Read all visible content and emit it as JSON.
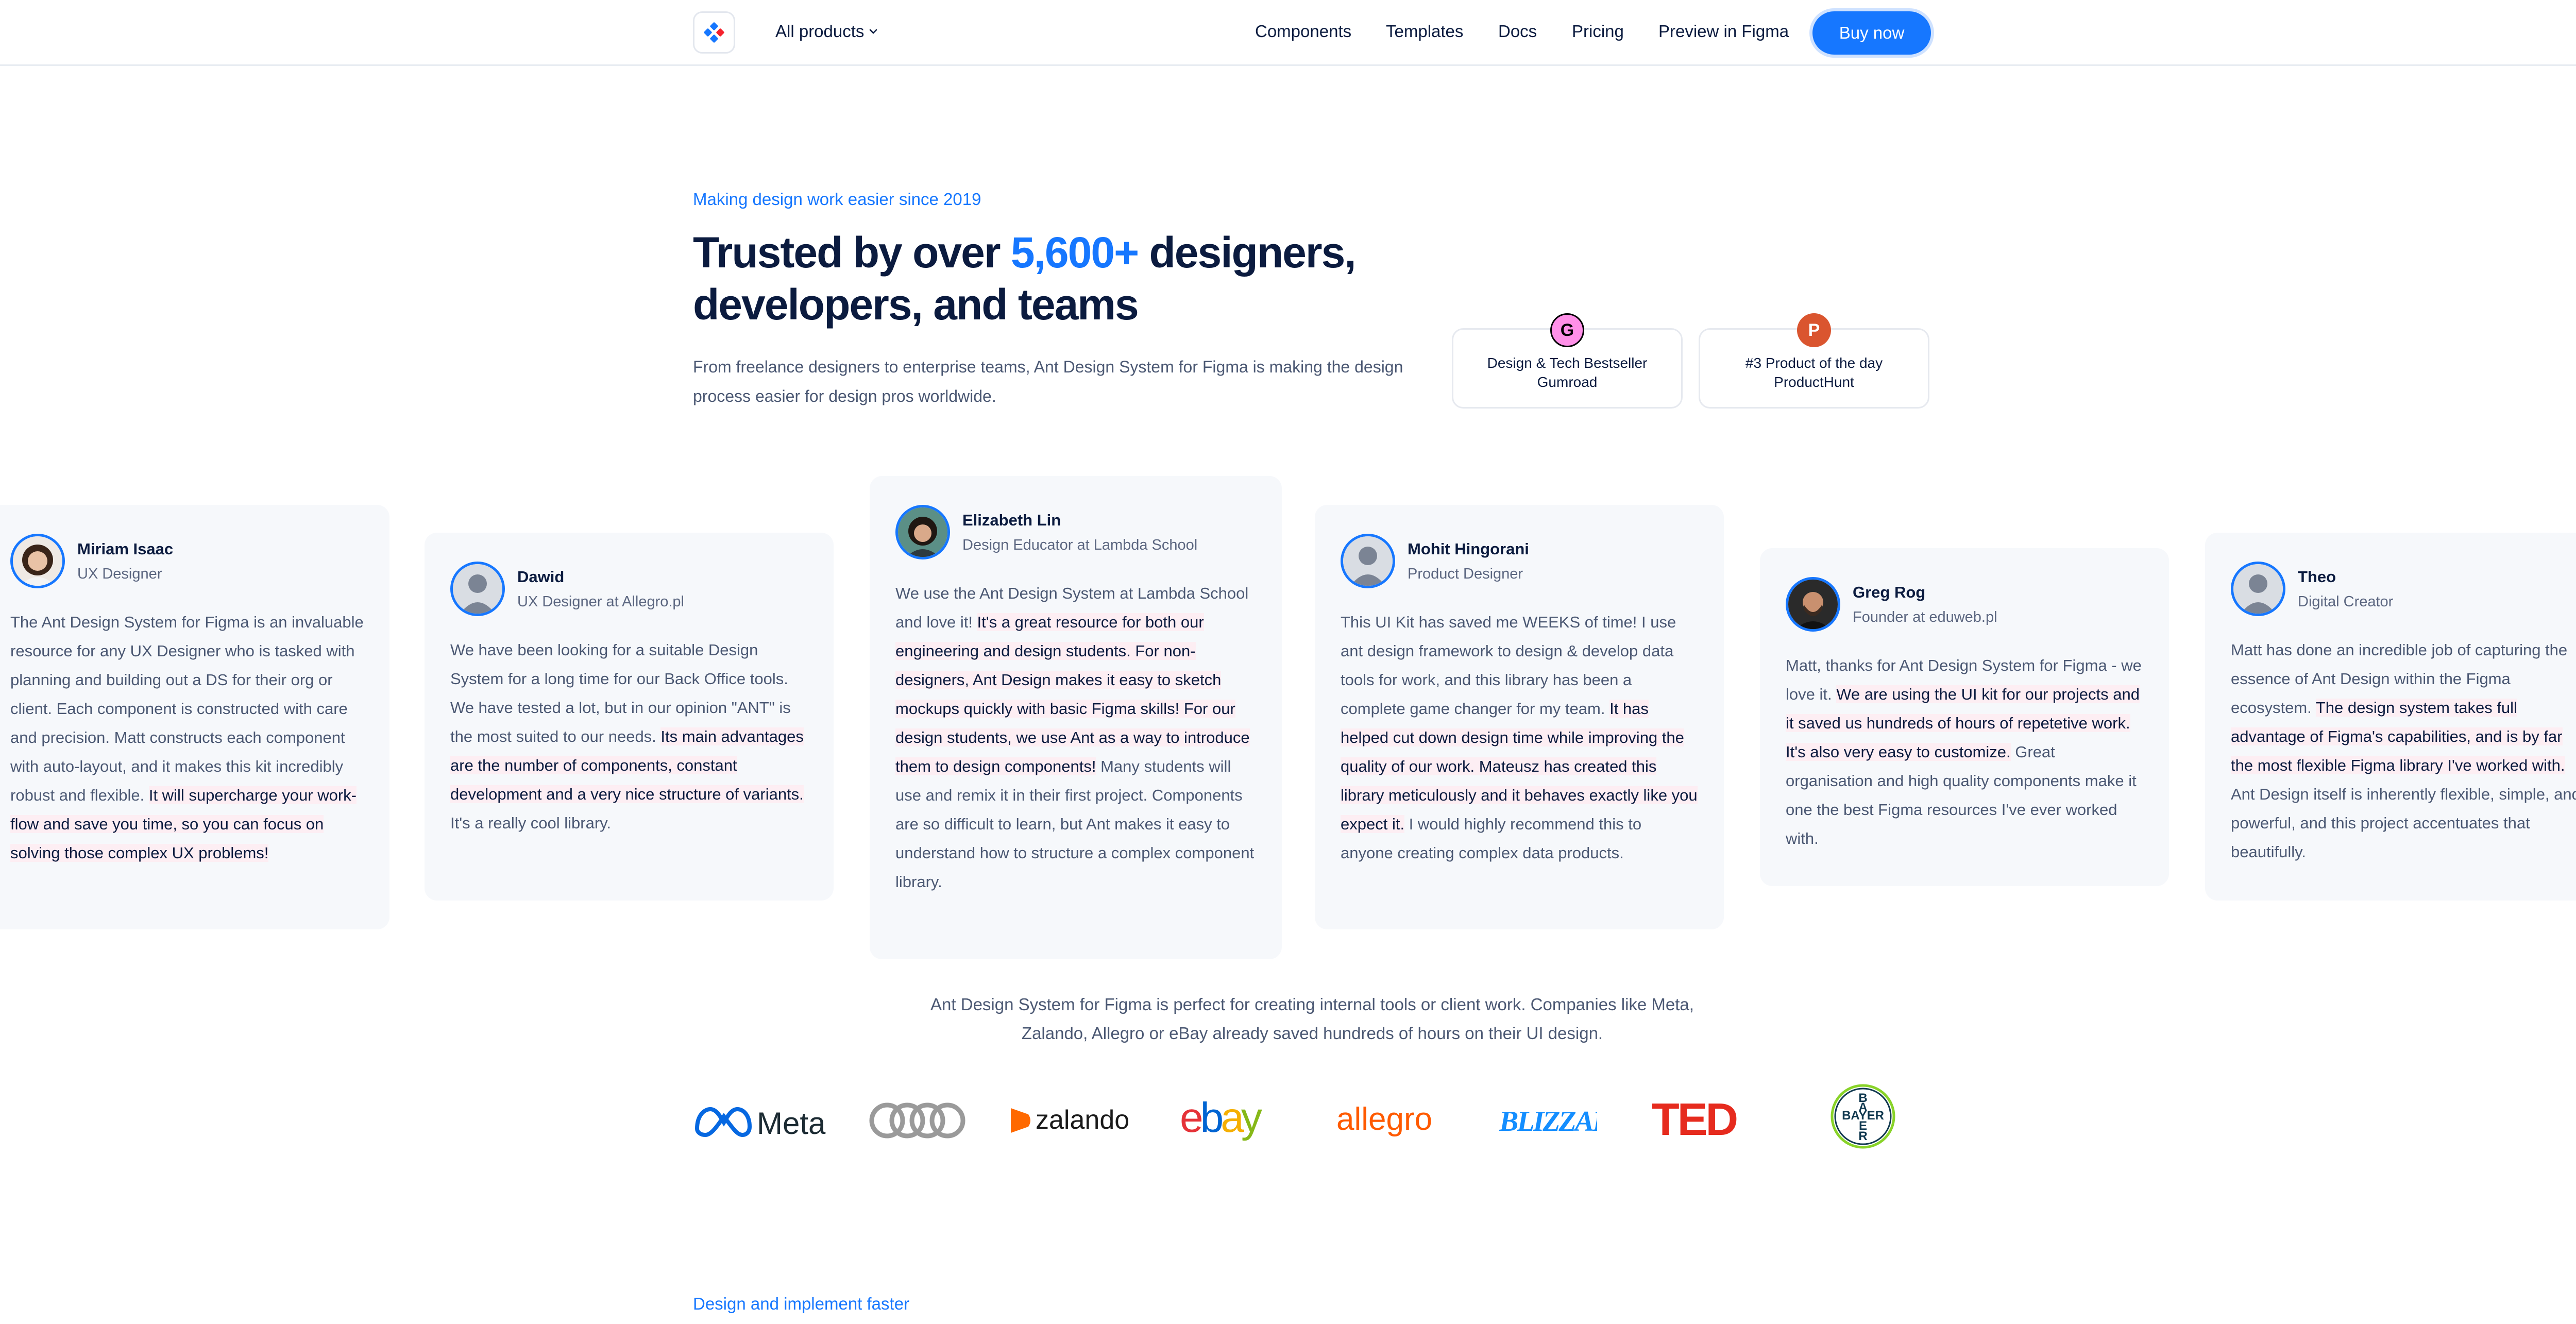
{
  "nav": {
    "products_label": "All products",
    "links": [
      "Components",
      "Templates",
      "Docs",
      "Pricing",
      "Preview in Figma"
    ],
    "buy_label": "Buy now"
  },
  "hero": {
    "eyebrow": "Making design work easier since 2019",
    "title_pre": "Trusted by over ",
    "title_accent": "5,600+",
    "title_post": " designers, developers, and teams",
    "subtitle": "From freelance designers to enterprise teams, Ant Design System for Figma is making the design process easier for design pros worldwide."
  },
  "awards": [
    {
      "badge": "G",
      "line1": "Design & Tech Bestseller",
      "line2": "Gumroad",
      "color": "#ff90e8"
    },
    {
      "badge": "P",
      "line1": "#3 Product of the day",
      "line2": "ProductHunt",
      "color": "#da552f"
    }
  ],
  "testimonials": [
    {
      "name": "Miriam Isaac",
      "role": "UX Designer",
      "avatar": "woman-curly-avatar",
      "quote_plain": "The Ant Design System for Figma is an invaluable resource for any UX Designer who is tasked with planning and building out a DS for their org or client. Each component is constructed with care and precision. Matt constructs each component with auto-layout, and it makes this kit incredibly robust and flexible. ",
      "quote_hl": "It will supercharge your work-flow and save you time, so you can focus on solving those complex UX problems!",
      "quote_end": ""
    },
    {
      "name": "Dawid",
      "role": "UX Designer at Allegro.pl",
      "avatar": "placeholder-avatar",
      "quote_plain": "We have been looking for a suitable Design System for a long time for our Back Office tools. We have tested a lot, but in our opinion \"ANT\" is the most suited to our needs. ",
      "quote_hl": "Its main advantages are the number of components, constant development and a very nice structure of variants.",
      "quote_end": " It's a really cool library."
    },
    {
      "name": "Elizabeth Lin",
      "role": "Design Educator at Lambda School",
      "avatar": "woman-photo-avatar",
      "quote_plain": "We use the Ant Design System at Lambda School and love it! ",
      "quote_hl": "It's a great resource for both our engineering and design students. For non-designers, Ant Design makes it easy to sketch mockups quickly with basic Figma skills! For our design students, we use Ant as a way to introduce them to design components!",
      "quote_end": " Many students will use and remix it in their first project. Components are so difficult to learn, but Ant makes it easy to understand how to structure a complex component library."
    },
    {
      "name": "Mohit Hingorani",
      "role": "Product Designer",
      "avatar": "placeholder-avatar",
      "quote_plain": "This UI Kit has saved me WEEKS of time! I use ant design framework to design & develop data tools for work, and this library has been a complete game changer for my team. ",
      "quote_hl": "It has helped cut down design time while improving the quality of our work. Mateusz has created this library meticulously and it behaves exactly like you expect it.",
      "quote_end": " I would highly recommend this to anyone creating complex data products."
    },
    {
      "name": "Greg Rog",
      "role": "Founder at eduweb.pl",
      "avatar": "man-photo-avatar",
      "quote_plain": "Matt, thanks for Ant Design System for Figma - we love it. ",
      "quote_hl": "We are using the UI kit for our projects and it saved us hundreds of hours of repetetive work. It's also very easy to customize.",
      "quote_end": " Great organisation and high quality components make it one the best Figma resources I've ever worked with."
    },
    {
      "name": "Theo",
      "role": "Digital Creator",
      "avatar": "placeholder-avatar",
      "quote_plain": "Matt has done an incredible job of capturing the essence of Ant Design within the Figma ecosystem. ",
      "quote_hl": "The design system takes full advantage of Figma's capabilities, and is by far the most flexible Figma library I've worked with.",
      "quote_end": " Ant Design itself is inherently flexible, simple, and powerful, and this project accentuates that beautifully."
    }
  ],
  "companies": {
    "text": "Ant Design System for Figma is perfect for creating internal tools or client work. Companies like Meta, Zalando, Allegro or eBay already saved hundreds of hours on their UI design.",
    "logos": [
      "Meta",
      "zalando",
      "allegro",
      "BLIZZARD",
      "TED",
      "BAYER"
    ]
  },
  "footer": {
    "eyebrow": "Design and implement faster"
  },
  "colors": {
    "accent": "#1677ff",
    "text": "#0b1b3f",
    "muted": "#4b5873",
    "highlight": "#fdeef3"
  }
}
